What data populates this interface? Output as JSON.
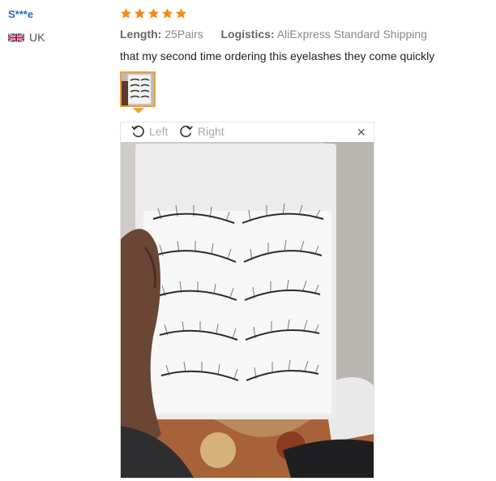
{
  "reviewer": {
    "name": "S***e",
    "country": "UK"
  },
  "rating": {
    "stars": 5,
    "max": 5,
    "star_color": "#f38b0f"
  },
  "attributes": {
    "length_label": "Length:",
    "length_value": "25Pairs",
    "logistics_label": "Logistics:",
    "logistics_value": "AliExpress Standard Shipping"
  },
  "review": {
    "text": "that my second time ordering this eyelashes they come quickly"
  },
  "viewer": {
    "rotate_left_label": "Left",
    "rotate_right_label": "Right",
    "close_label": "×"
  },
  "colors": {
    "accent": "#f0a030",
    "name_link": "#2a6ab8"
  }
}
